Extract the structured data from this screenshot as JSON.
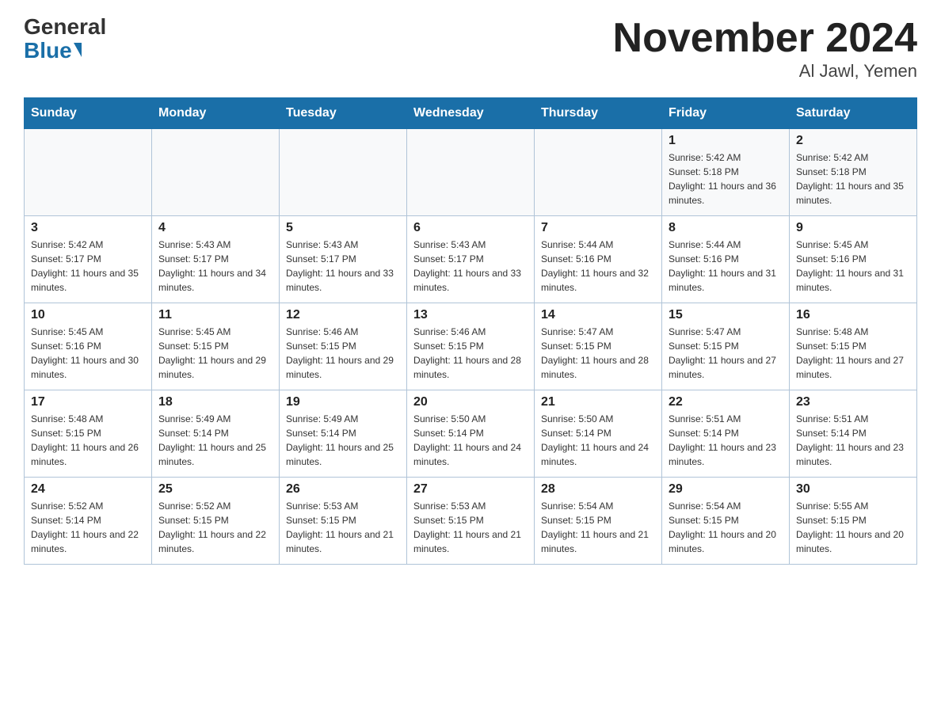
{
  "logo": {
    "general": "General",
    "blue": "Blue"
  },
  "title": "November 2024",
  "location": "Al Jawl, Yemen",
  "days_of_week": [
    "Sunday",
    "Monday",
    "Tuesday",
    "Wednesday",
    "Thursday",
    "Friday",
    "Saturday"
  ],
  "weeks": [
    [
      {
        "day": "",
        "info": ""
      },
      {
        "day": "",
        "info": ""
      },
      {
        "day": "",
        "info": ""
      },
      {
        "day": "",
        "info": ""
      },
      {
        "day": "",
        "info": ""
      },
      {
        "day": "1",
        "info": "Sunrise: 5:42 AM\nSunset: 5:18 PM\nDaylight: 11 hours and 36 minutes."
      },
      {
        "day": "2",
        "info": "Sunrise: 5:42 AM\nSunset: 5:18 PM\nDaylight: 11 hours and 35 minutes."
      }
    ],
    [
      {
        "day": "3",
        "info": "Sunrise: 5:42 AM\nSunset: 5:17 PM\nDaylight: 11 hours and 35 minutes."
      },
      {
        "day": "4",
        "info": "Sunrise: 5:43 AM\nSunset: 5:17 PM\nDaylight: 11 hours and 34 minutes."
      },
      {
        "day": "5",
        "info": "Sunrise: 5:43 AM\nSunset: 5:17 PM\nDaylight: 11 hours and 33 minutes."
      },
      {
        "day": "6",
        "info": "Sunrise: 5:43 AM\nSunset: 5:17 PM\nDaylight: 11 hours and 33 minutes."
      },
      {
        "day": "7",
        "info": "Sunrise: 5:44 AM\nSunset: 5:16 PM\nDaylight: 11 hours and 32 minutes."
      },
      {
        "day": "8",
        "info": "Sunrise: 5:44 AM\nSunset: 5:16 PM\nDaylight: 11 hours and 31 minutes."
      },
      {
        "day": "9",
        "info": "Sunrise: 5:45 AM\nSunset: 5:16 PM\nDaylight: 11 hours and 31 minutes."
      }
    ],
    [
      {
        "day": "10",
        "info": "Sunrise: 5:45 AM\nSunset: 5:16 PM\nDaylight: 11 hours and 30 minutes."
      },
      {
        "day": "11",
        "info": "Sunrise: 5:45 AM\nSunset: 5:15 PM\nDaylight: 11 hours and 29 minutes."
      },
      {
        "day": "12",
        "info": "Sunrise: 5:46 AM\nSunset: 5:15 PM\nDaylight: 11 hours and 29 minutes."
      },
      {
        "day": "13",
        "info": "Sunrise: 5:46 AM\nSunset: 5:15 PM\nDaylight: 11 hours and 28 minutes."
      },
      {
        "day": "14",
        "info": "Sunrise: 5:47 AM\nSunset: 5:15 PM\nDaylight: 11 hours and 28 minutes."
      },
      {
        "day": "15",
        "info": "Sunrise: 5:47 AM\nSunset: 5:15 PM\nDaylight: 11 hours and 27 minutes."
      },
      {
        "day": "16",
        "info": "Sunrise: 5:48 AM\nSunset: 5:15 PM\nDaylight: 11 hours and 27 minutes."
      }
    ],
    [
      {
        "day": "17",
        "info": "Sunrise: 5:48 AM\nSunset: 5:15 PM\nDaylight: 11 hours and 26 minutes."
      },
      {
        "day": "18",
        "info": "Sunrise: 5:49 AM\nSunset: 5:14 PM\nDaylight: 11 hours and 25 minutes."
      },
      {
        "day": "19",
        "info": "Sunrise: 5:49 AM\nSunset: 5:14 PM\nDaylight: 11 hours and 25 minutes."
      },
      {
        "day": "20",
        "info": "Sunrise: 5:50 AM\nSunset: 5:14 PM\nDaylight: 11 hours and 24 minutes."
      },
      {
        "day": "21",
        "info": "Sunrise: 5:50 AM\nSunset: 5:14 PM\nDaylight: 11 hours and 24 minutes."
      },
      {
        "day": "22",
        "info": "Sunrise: 5:51 AM\nSunset: 5:14 PM\nDaylight: 11 hours and 23 minutes."
      },
      {
        "day": "23",
        "info": "Sunrise: 5:51 AM\nSunset: 5:14 PM\nDaylight: 11 hours and 23 minutes."
      }
    ],
    [
      {
        "day": "24",
        "info": "Sunrise: 5:52 AM\nSunset: 5:14 PM\nDaylight: 11 hours and 22 minutes."
      },
      {
        "day": "25",
        "info": "Sunrise: 5:52 AM\nSunset: 5:15 PM\nDaylight: 11 hours and 22 minutes."
      },
      {
        "day": "26",
        "info": "Sunrise: 5:53 AM\nSunset: 5:15 PM\nDaylight: 11 hours and 21 minutes."
      },
      {
        "day": "27",
        "info": "Sunrise: 5:53 AM\nSunset: 5:15 PM\nDaylight: 11 hours and 21 minutes."
      },
      {
        "day": "28",
        "info": "Sunrise: 5:54 AM\nSunset: 5:15 PM\nDaylight: 11 hours and 21 minutes."
      },
      {
        "day": "29",
        "info": "Sunrise: 5:54 AM\nSunset: 5:15 PM\nDaylight: 11 hours and 20 minutes."
      },
      {
        "day": "30",
        "info": "Sunrise: 5:55 AM\nSunset: 5:15 PM\nDaylight: 11 hours and 20 minutes."
      }
    ]
  ],
  "colors": {
    "header_bg": "#1a6fa8",
    "header_text": "#ffffff",
    "border": "#b0c4d8"
  }
}
